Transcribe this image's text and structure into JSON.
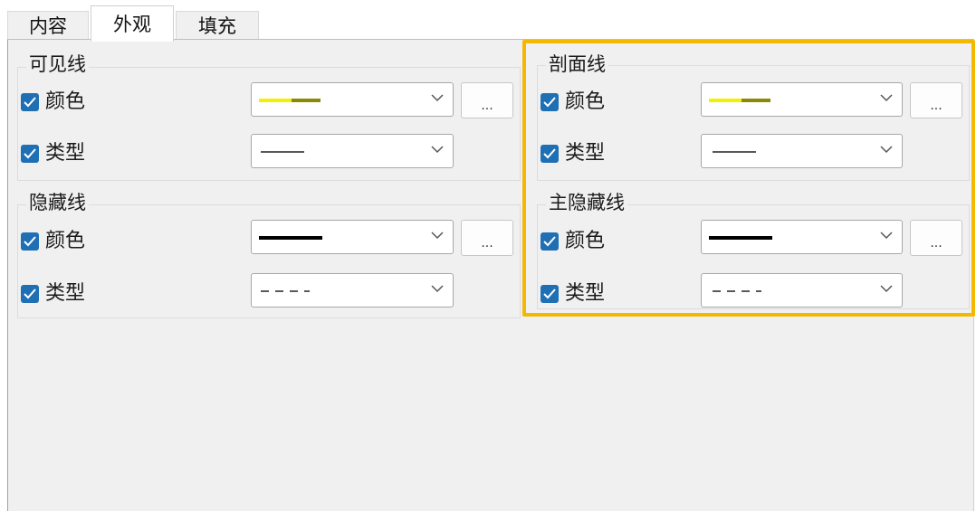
{
  "tabs": [
    {
      "label": "内容",
      "active": false
    },
    {
      "label": "外观",
      "active": true
    },
    {
      "label": "填充",
      "active": false
    }
  ],
  "groups": {
    "visible": {
      "title": "可见线",
      "color_label": "颜色",
      "type_label": "类型",
      "dots": "..."
    },
    "hidden": {
      "title": "隐藏线",
      "color_label": "颜色",
      "type_label": "类型",
      "dots": "..."
    },
    "section": {
      "title": "剖面线",
      "color_label": "颜色",
      "type_label": "类型",
      "dots": "..."
    },
    "main_hidden": {
      "title": "主隐藏线",
      "color_label": "颜色",
      "type_label": "类型",
      "dots": "..."
    }
  },
  "colors": {
    "checkbox": "#1f6fb5",
    "highlight": "#f5b800",
    "yellow_swatch": "#f2f200",
    "olive_swatch": "#8a8a00",
    "black_swatch": "#000000"
  }
}
